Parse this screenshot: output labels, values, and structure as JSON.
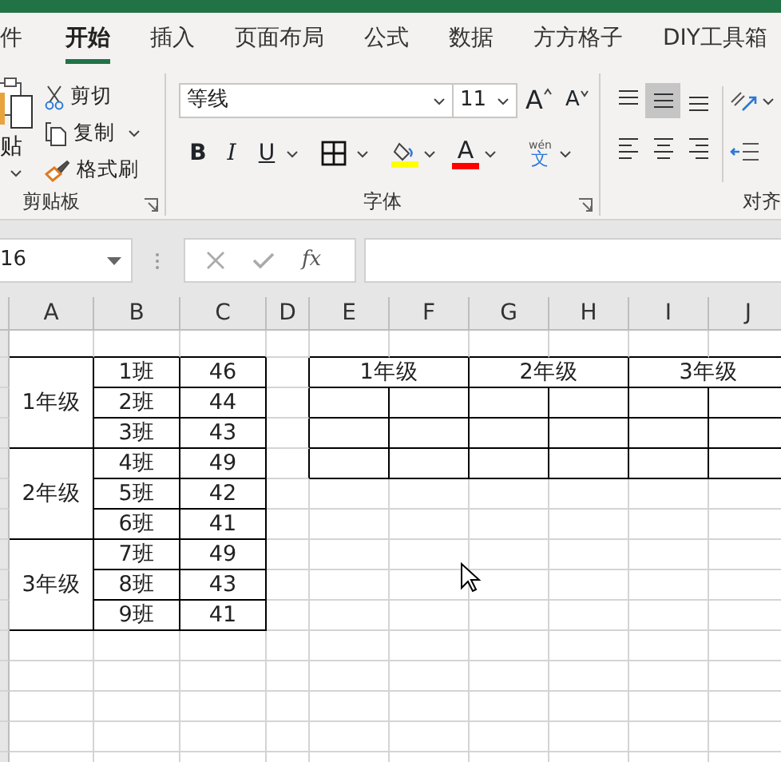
{
  "tabs": [
    {
      "label": "件",
      "selected": false
    },
    {
      "label": "开始",
      "selected": true
    },
    {
      "label": "插入",
      "selected": false
    },
    {
      "label": "页面布局",
      "selected": false
    },
    {
      "label": "公式",
      "selected": false
    },
    {
      "label": "数据",
      "selected": false
    },
    {
      "label": "方方格子",
      "selected": false
    },
    {
      "label": "DIY工具箱",
      "selected": false
    }
  ],
  "clipboard": {
    "paste": "贴",
    "cut": "剪切",
    "copy": "复制",
    "format_painter": "格式刷",
    "label": "剪贴板"
  },
  "font": {
    "name": "等线",
    "size": "11",
    "grow": "A",
    "shrink": "A",
    "bold": "B",
    "italic": "I",
    "underline": "U",
    "font_color": "A",
    "phonetic_top": "wén",
    "phonetic": "文",
    "label": "字体"
  },
  "alignment": {
    "label": "对齐",
    "buttons": [
      {
        "kind": "top",
        "selected": false
      },
      {
        "kind": "middle",
        "selected": true
      },
      {
        "kind": "bottom",
        "selected": false
      },
      {
        "kind": "left",
        "selected": false
      },
      {
        "kind": "center",
        "selected": false
      },
      {
        "kind": "right",
        "selected": false
      }
    ]
  },
  "formula_bar": {
    "name_box": "16",
    "function_button": "fx"
  },
  "sheet": {
    "columns": [
      "A",
      "B",
      "C",
      "D",
      "E",
      "F",
      "G",
      "H",
      "I",
      "J"
    ],
    "grades": [
      {
        "grade": "1年级",
        "classes": [
          {
            "class": "1班",
            "count": "46"
          },
          {
            "class": "2班",
            "count": "44"
          },
          {
            "class": "3班",
            "count": "43"
          }
        ]
      },
      {
        "grade": "2年级",
        "classes": [
          {
            "class": "4班",
            "count": "49"
          },
          {
            "class": "5班",
            "count": "42"
          },
          {
            "class": "6班",
            "count": "41"
          }
        ]
      },
      {
        "grade": "3年级",
        "classes": [
          {
            "class": "7班",
            "count": "49"
          },
          {
            "class": "8班",
            "count": "43"
          },
          {
            "class": "9班",
            "count": "41"
          }
        ]
      }
    ],
    "summary_headers": [
      "1年级",
      "2年级",
      "3年级"
    ]
  }
}
